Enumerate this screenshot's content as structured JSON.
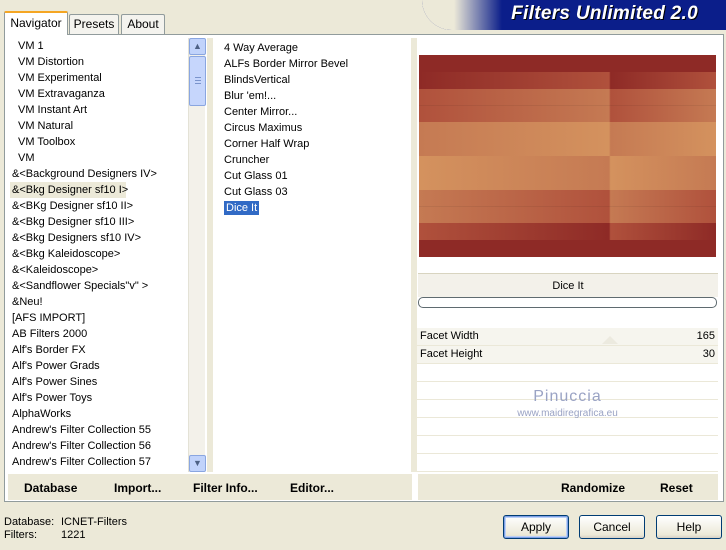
{
  "tabs": [
    "Navigator",
    "Presets",
    "About"
  ],
  "brand": "Filters Unlimited 2.0",
  "categories": [
    "VM 1",
    "VM Distortion",
    "VM Experimental",
    "VM Extravaganza",
    "VM Instant Art",
    "VM Natural",
    "VM Toolbox",
    "VM",
    "&<Background Designers IV>",
    "&<Bkg Designer sf10 I>",
    "&<BKg Designer sf10 II>",
    "&<Bkg Designer sf10 III>",
    "&<Bkg Designers sf10 IV>",
    "&<Bkg Kaleidoscope>",
    "&<Kaleidoscope>",
    "&<Sandflower Specials\"v\" >",
    "&Neu!",
    "[AFS IMPORT]",
    "AB Filters 2000",
    "Alf's Border FX",
    "Alf's Power Grads",
    "Alf's Power Sines",
    "Alf's Power Toys",
    "AlphaWorks",
    "Andrew's Filter Collection 55",
    "Andrew's Filter Collection 56",
    "Andrew's Filter Collection 57"
  ],
  "selected_category": "&<Bkg Designer sf10 I>",
  "filters": [
    "4 Way Average",
    "ALFs Border Mirror Bevel",
    "BlindsVertical",
    "Blur 'em!...",
    "Center Mirror...",
    "Circus Maximus",
    "Corner Half Wrap",
    "Cruncher",
    "Cut Glass 01",
    "Cut Glass 03",
    "Dice It"
  ],
  "selected_filter": "Dice It",
  "preview_filter_name": "Dice It",
  "params": [
    {
      "label": "Facet Width",
      "value": "165"
    },
    {
      "label": "Facet Height",
      "value": "30"
    }
  ],
  "watermark": {
    "line1": "Pinuccia",
    "line2": "www.maidiregrafica.eu"
  },
  "left_buttons": [
    "Database",
    "Import...",
    "Filter Info...",
    "Editor..."
  ],
  "right_buttons": [
    "Randomize",
    "Reset"
  ],
  "info": {
    "database_label": "Database:",
    "database_value": "ICNET-Filters",
    "filters_label": "Filters:",
    "filters_value": "1221"
  },
  "dialog_buttons": {
    "apply": "Apply",
    "cancel": "Cancel",
    "help": "Help"
  },
  "preview_colors": [
    "#8e2a26",
    "#b0513c",
    "#c57a53",
    "#d4925e",
    "#c57a53",
    "#b0513c",
    "#8e2a26"
  ]
}
